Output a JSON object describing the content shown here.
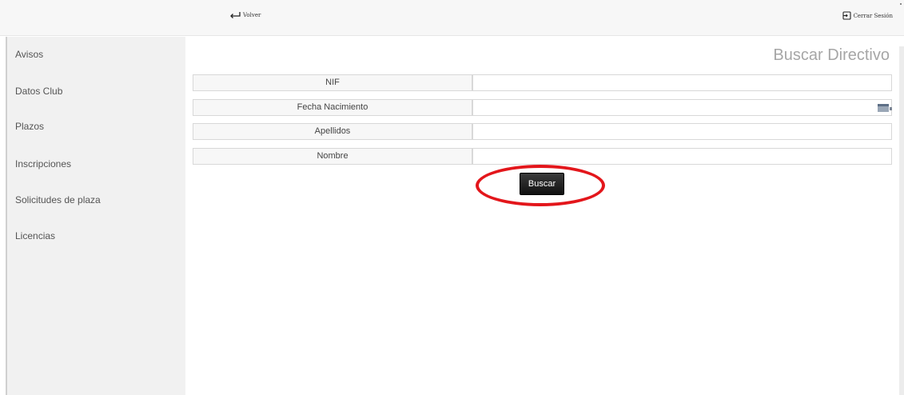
{
  "header": {
    "back_label": "Volver",
    "logout_label": "Cerrar Sesión"
  },
  "sidebar": {
    "items": [
      {
        "label": "Avisos"
      },
      {
        "label": "Datos Club"
      },
      {
        "label": "Plazos"
      },
      {
        "label": "Inscripciones"
      },
      {
        "label": "Solicitudes de plaza"
      },
      {
        "label": "Licencias"
      }
    ]
  },
  "main": {
    "title": "Buscar Directivo",
    "form": {
      "fields": [
        {
          "label": "NIF",
          "value": ""
        },
        {
          "label": "Fecha Nacimiento",
          "value": ""
        },
        {
          "label": "Apellidos",
          "value": ""
        },
        {
          "label": "Nombre",
          "value": ""
        }
      ],
      "submit_label": "Buscar"
    }
  },
  "colors": {
    "highlight": "#e3161b",
    "button": "#1b1b1b",
    "title": "#a6a6a6"
  }
}
